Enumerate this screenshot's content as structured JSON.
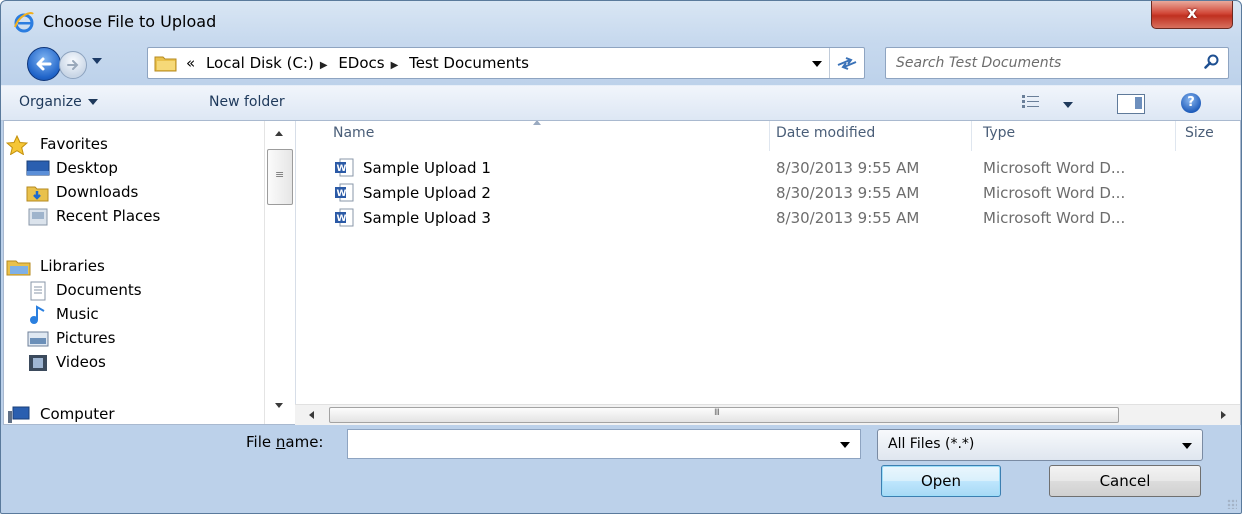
{
  "window": {
    "title": "Choose File to Upload",
    "close_glyph": "x"
  },
  "nav": {
    "address_overflow": "«",
    "breadcrumbs": [
      "Local Disk (C:)",
      "EDocs",
      "Test Documents"
    ],
    "search_placeholder": "Search Test Documents"
  },
  "toolbar": {
    "organize_label": "Organize",
    "new_folder_label": "New folder",
    "help_glyph": "?"
  },
  "sidebar": {
    "favorites": {
      "label": "Favorites",
      "icon": "star-icon"
    },
    "favorites_items": [
      {
        "label": "Desktop",
        "icon": "desktop-icon"
      },
      {
        "label": "Downloads",
        "icon": "downloads-folder-icon"
      },
      {
        "label": "Recent Places",
        "icon": "recent-places-icon"
      }
    ],
    "libraries": {
      "label": "Libraries",
      "icon": "libraries-icon"
    },
    "libraries_items": [
      {
        "label": "Documents",
        "icon": "documents-icon"
      },
      {
        "label": "Music",
        "icon": "music-icon"
      },
      {
        "label": "Pictures",
        "icon": "pictures-icon"
      },
      {
        "label": "Videos",
        "icon": "videos-icon"
      }
    ],
    "computer": {
      "label": "Computer",
      "icon": "computer-icon"
    }
  },
  "file_list": {
    "columns": [
      "Name",
      "Date modified",
      "Type",
      "Size"
    ],
    "rows": [
      {
        "name": "Sample Upload 1",
        "date": "8/30/2013 9:55 AM",
        "type": "Microsoft Word D...",
        "icon": "word-document-icon"
      },
      {
        "name": "Sample Upload 2",
        "date": "8/30/2013 9:55 AM",
        "type": "Microsoft Word D...",
        "icon": "word-document-icon"
      },
      {
        "name": "Sample Upload 3",
        "date": "8/30/2013 9:55 AM",
        "type": "Microsoft Word D...",
        "icon": "word-document-icon"
      }
    ]
  },
  "bottom": {
    "file_name_label_prefix": "File ",
    "file_name_label_mnemonic": "n",
    "file_name_label_suffix": "ame:",
    "file_name_value": "",
    "filter_value": "All Files (*.*)",
    "open_label": "Open",
    "cancel_label": "Cancel"
  },
  "colors": {
    "chrome": "#c7d9ee",
    "close_button": "#c84a3b",
    "toolbar_text": "#1e395b",
    "secondary_text": "#6d6d6d"
  }
}
